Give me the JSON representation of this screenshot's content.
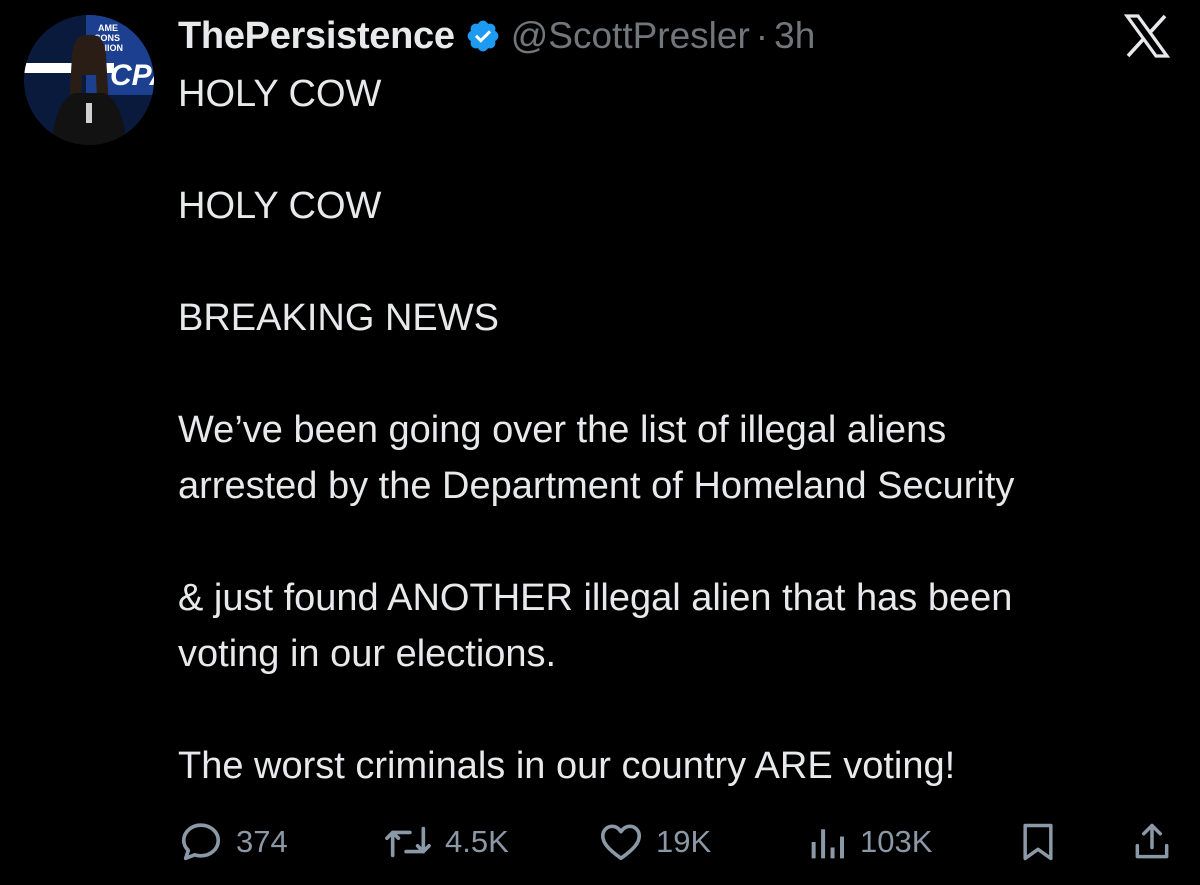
{
  "author": {
    "display_name": "ThePersistence",
    "handle": "@ScottPresler",
    "separator": "·",
    "time": "3h",
    "verified": true,
    "avatar_backdrop_text": [
      "AME",
      "CONS",
      "UNION",
      "CPA"
    ]
  },
  "platform_logo": "x-logo-icon",
  "tweet": {
    "paragraphs": [
      [
        "HOLY COW"
      ],
      [
        "HOLY COW"
      ],
      [
        "BREAKING NEWS"
      ],
      [
        "We’ve been going over the list of illegal aliens",
        "arrested by the Department of Homeland Security"
      ],
      [
        "& just found ANOTHER illegal alien that has been",
        "voting in our elections."
      ],
      [
        "The worst criminals in our country ARE voting!"
      ]
    ]
  },
  "actions": {
    "replies": {
      "icon": "reply-icon",
      "count": "374"
    },
    "reposts": {
      "icon": "repost-icon",
      "count": "4.5K"
    },
    "likes": {
      "icon": "heart-icon",
      "count": "19K"
    },
    "views": {
      "icon": "views-icon",
      "count": "103K"
    },
    "bookmark": {
      "icon": "bookmark-icon"
    },
    "share": {
      "icon": "share-icon"
    }
  },
  "colors": {
    "background": "#000000",
    "text_primary": "#e7e9ea",
    "text_secondary": "#71767b",
    "verified_badge": "#1d9bf0",
    "icon_gray": "#8b98a5"
  }
}
